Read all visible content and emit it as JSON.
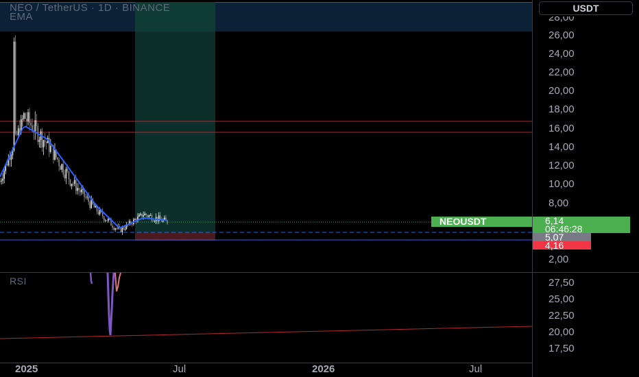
{
  "header": {
    "symbol_line": "NEO / TetherUS · 1D · BINANCE",
    "indicator": "EMA"
  },
  "currency_button": "USDT",
  "rsi_label": "RSI",
  "price_axis": {
    "ticks": [
      "26,00",
      "24,00",
      "22,00",
      "20,00",
      "18,00",
      "16,00",
      "14,00",
      "12,00",
      "10,00",
      "8,00",
      "2,00"
    ],
    "top_cut_tick": "28,00"
  },
  "rsi_axis": {
    "ticks": [
      "27,50",
      "25,00",
      "22,50",
      "20,00",
      "17,50"
    ]
  },
  "time_axis": {
    "ticks": [
      {
        "label": "2025",
        "bold": true
      },
      {
        "label": "Jul",
        "bold": false
      },
      {
        "label": "2026",
        "bold": true
      },
      {
        "label": "Jul",
        "bold": false
      }
    ]
  },
  "tags": {
    "symbol_tag": "NEOUSDT",
    "last_price": "6,14",
    "countdown": "06:46:28",
    "level_gray": "5,07",
    "level_red": "4,16"
  },
  "colors": {
    "background": "#000000",
    "ema": "#2962ff",
    "zone_green": "#0f3b33",
    "zone_red": "#5a1f24",
    "header_band": "#102a3f",
    "tag_green": "#4caf50",
    "tag_red": "#f23645",
    "tag_gray": "#787b86",
    "rsi_line": "#7e57c2",
    "trendline": "#b22833"
  },
  "chart_data": {
    "type": "line",
    "title": "NEO / TetherUS · 1D · BINANCE",
    "price_ylim": [
      1,
      28
    ],
    "x": [
      "2024-12",
      "2025-01",
      "2025-02",
      "2025-03",
      "2025-04",
      "2025-05",
      "2025-06",
      "2025-07"
    ],
    "series": [
      {
        "name": "EMA",
        "values": [
          11.0,
          16.5,
          15.0,
          11.5,
          8.0,
          5.5,
          6.6,
          6.3
        ]
      }
    ],
    "close": [
      10.5,
      17.5,
      14.5,
      10.5,
      7.5,
      5.2,
      7.0,
      6.14
    ],
    "horizontal_levels": [
      16.8,
      15.6,
      6.14,
      5.07,
      4.16
    ],
    "last_price": 6.14,
    "rsi": {
      "ylim": [
        16,
        30
      ],
      "trendline": [
        19.5,
        21.2
      ]
    }
  }
}
